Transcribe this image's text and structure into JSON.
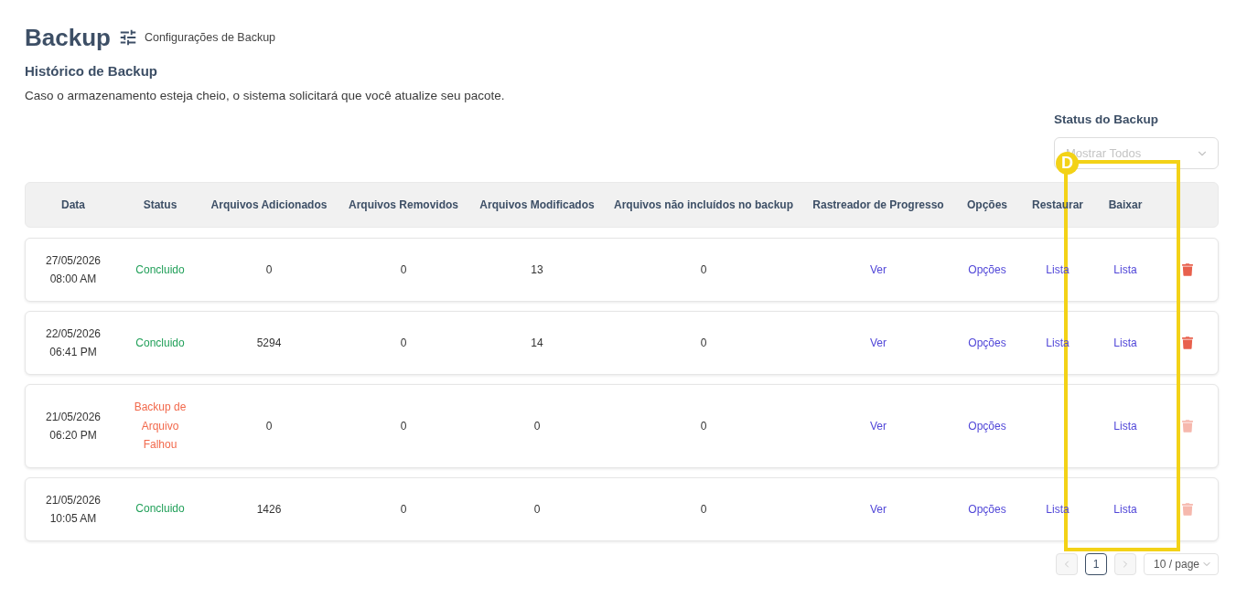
{
  "header": {
    "title": "Backup",
    "settings_link": "Configurações de Backup"
  },
  "history": {
    "title": "Histórico de Backup",
    "description": "Caso o armazenamento esteja cheio, o sistema solicitará que você atualize seu pacote."
  },
  "filter": {
    "label": "Status do Backup",
    "select": {
      "placeholder": "Mostrar Todos"
    }
  },
  "table": {
    "columns": [
      "Data",
      "Status",
      "Arquivos Adicionados",
      "Arquivos Removidos",
      "Arquivos Modificados",
      "Arquivos não incluídos no backup",
      "Rastreador de Progresso",
      "Opções",
      "Restaurar",
      "Baixar"
    ],
    "rows": [
      {
        "date": "27/05/2026",
        "time": "08:00 AM",
        "status": {
          "text": "Concluido",
          "kind": "success"
        },
        "added": "0",
        "removed": "0",
        "modified": "13",
        "excluded": "0",
        "progress": "Ver",
        "options": "Opções",
        "restore": "Lista",
        "download": "Lista",
        "delete": {
          "disabled": false
        }
      },
      {
        "date": "22/05/2026",
        "time": "06:41 PM",
        "status": {
          "text": "Concluido",
          "kind": "success"
        },
        "added": "5294",
        "removed": "0",
        "modified": "14",
        "excluded": "0",
        "progress": "Ver",
        "options": "Opções",
        "restore": "Lista",
        "download": "Lista",
        "delete": {
          "disabled": false
        }
      },
      {
        "date": "21/05/2026",
        "time": "06:20 PM",
        "status": {
          "text": "Backup de Arquivo Falhou",
          "kind": "failed"
        },
        "added": "0",
        "removed": "0",
        "modified": "0",
        "excluded": "0",
        "progress": "Ver",
        "options": "Opções",
        "download": "Lista",
        "delete": {
          "disabled": true
        }
      },
      {
        "date": "21/05/2026",
        "time": "10:05 AM",
        "status": {
          "text": "Concluido",
          "kind": "success"
        },
        "added": "1426",
        "removed": "0",
        "modified": "0",
        "excluded": "0",
        "progress": "Ver",
        "options": "Opções",
        "restore": "Lista",
        "download": "Lista",
        "delete": {
          "disabled": true
        }
      }
    ]
  },
  "pagination": {
    "prev": {
      "disabled": true
    },
    "pages": [
      {
        "label": "1",
        "selected": true
      }
    ],
    "next": {
      "disabled": true
    },
    "page_size": "10 / page"
  },
  "annotation": {
    "label": "D"
  }
}
